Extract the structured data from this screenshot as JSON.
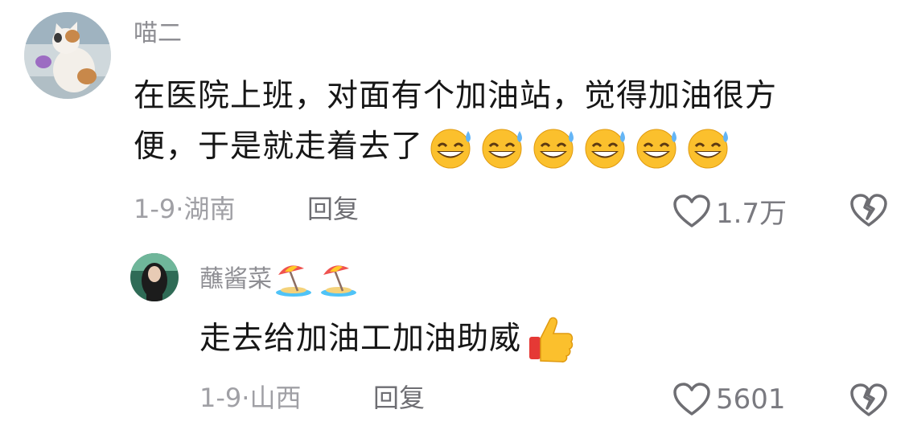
{
  "comment": {
    "username": "喵二",
    "text_line1": "在医院上班，对面有个加油站，觉得加油很方",
    "text_line2": "便，于是就走着去了",
    "emoji_name": "grinning-sweat-emoji",
    "emoji_count": 6,
    "date": "1-9·",
    "location": "湖南",
    "reply_label": "回复",
    "likes": "1.7万"
  },
  "reply": {
    "username": "蘸酱菜",
    "name_emojis": [
      "beach-umbrella-emoji",
      "beach-umbrella-emoji"
    ],
    "text": "走去给加油工加油助威",
    "emoji_name": "thumbs-up-emoji",
    "date": "1-9·",
    "location": "山西",
    "reply_label": "回复",
    "likes": "5601"
  },
  "colors": {
    "muted_text": "#8e8e93",
    "body_text": "#161616",
    "icon_gray": "#6e6e73"
  }
}
